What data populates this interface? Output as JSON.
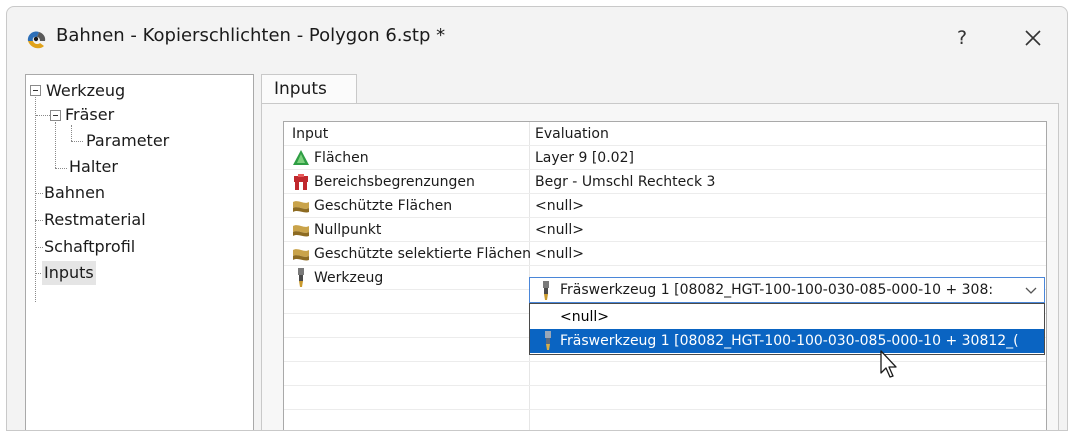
{
  "window": {
    "title": "Bahnen - Kopierschlichten - Polygon 6.stp *",
    "help_label": "?",
    "icons": {
      "app": "app-logo-icon",
      "close": "close-icon"
    }
  },
  "tree": {
    "items": [
      {
        "label": "Werkzeug",
        "expandable": true
      },
      {
        "label": "Fräser",
        "expandable": true
      },
      {
        "label": "Parameter"
      },
      {
        "label": "Halter"
      },
      {
        "label": "Bahnen"
      },
      {
        "label": "Restmaterial"
      },
      {
        "label": "Schaftprofil"
      },
      {
        "label": "Inputs",
        "selected": true
      }
    ]
  },
  "tabs": [
    {
      "label": "Inputs",
      "active": true
    }
  ],
  "grid": {
    "headers": {
      "input": "Input",
      "evaluation": "Evaluation"
    },
    "rows": [
      {
        "input": "Flächen",
        "evaluation": "Layer 9 [0.02]",
        "icon": "green-triangle-icon"
      },
      {
        "input": "Bereichsbegrenzungen",
        "evaluation": "Begr - Umschl Rechteck 3",
        "icon": "red-boundary-icon"
      },
      {
        "input": "Geschützte Flächen",
        "evaluation": "<null>",
        "icon": "surface-icon"
      },
      {
        "input": "Nullpunkt",
        "evaluation": "<null>",
        "icon": "surface-icon"
      },
      {
        "input": "Geschützte selektierte Flächen",
        "evaluation": "<null>",
        "icon": "surface-icon"
      },
      {
        "input": "Werkzeug",
        "evaluation": "",
        "icon": "milling-tool-icon"
      }
    ],
    "colors": {
      "selection": "#0a64c2",
      "focus_border": "#4a86d8"
    }
  },
  "combo": {
    "value": "Fräswerkzeug 1 [08082_HGT-100-100-030-085-000-10 + 308:",
    "options": [
      {
        "label": "<null>",
        "highlighted": false
      },
      {
        "label": "Fräswerkzeug 1 [08082_HGT-100-100-030-085-000-10 + 30812_(",
        "highlighted": true
      }
    ]
  }
}
